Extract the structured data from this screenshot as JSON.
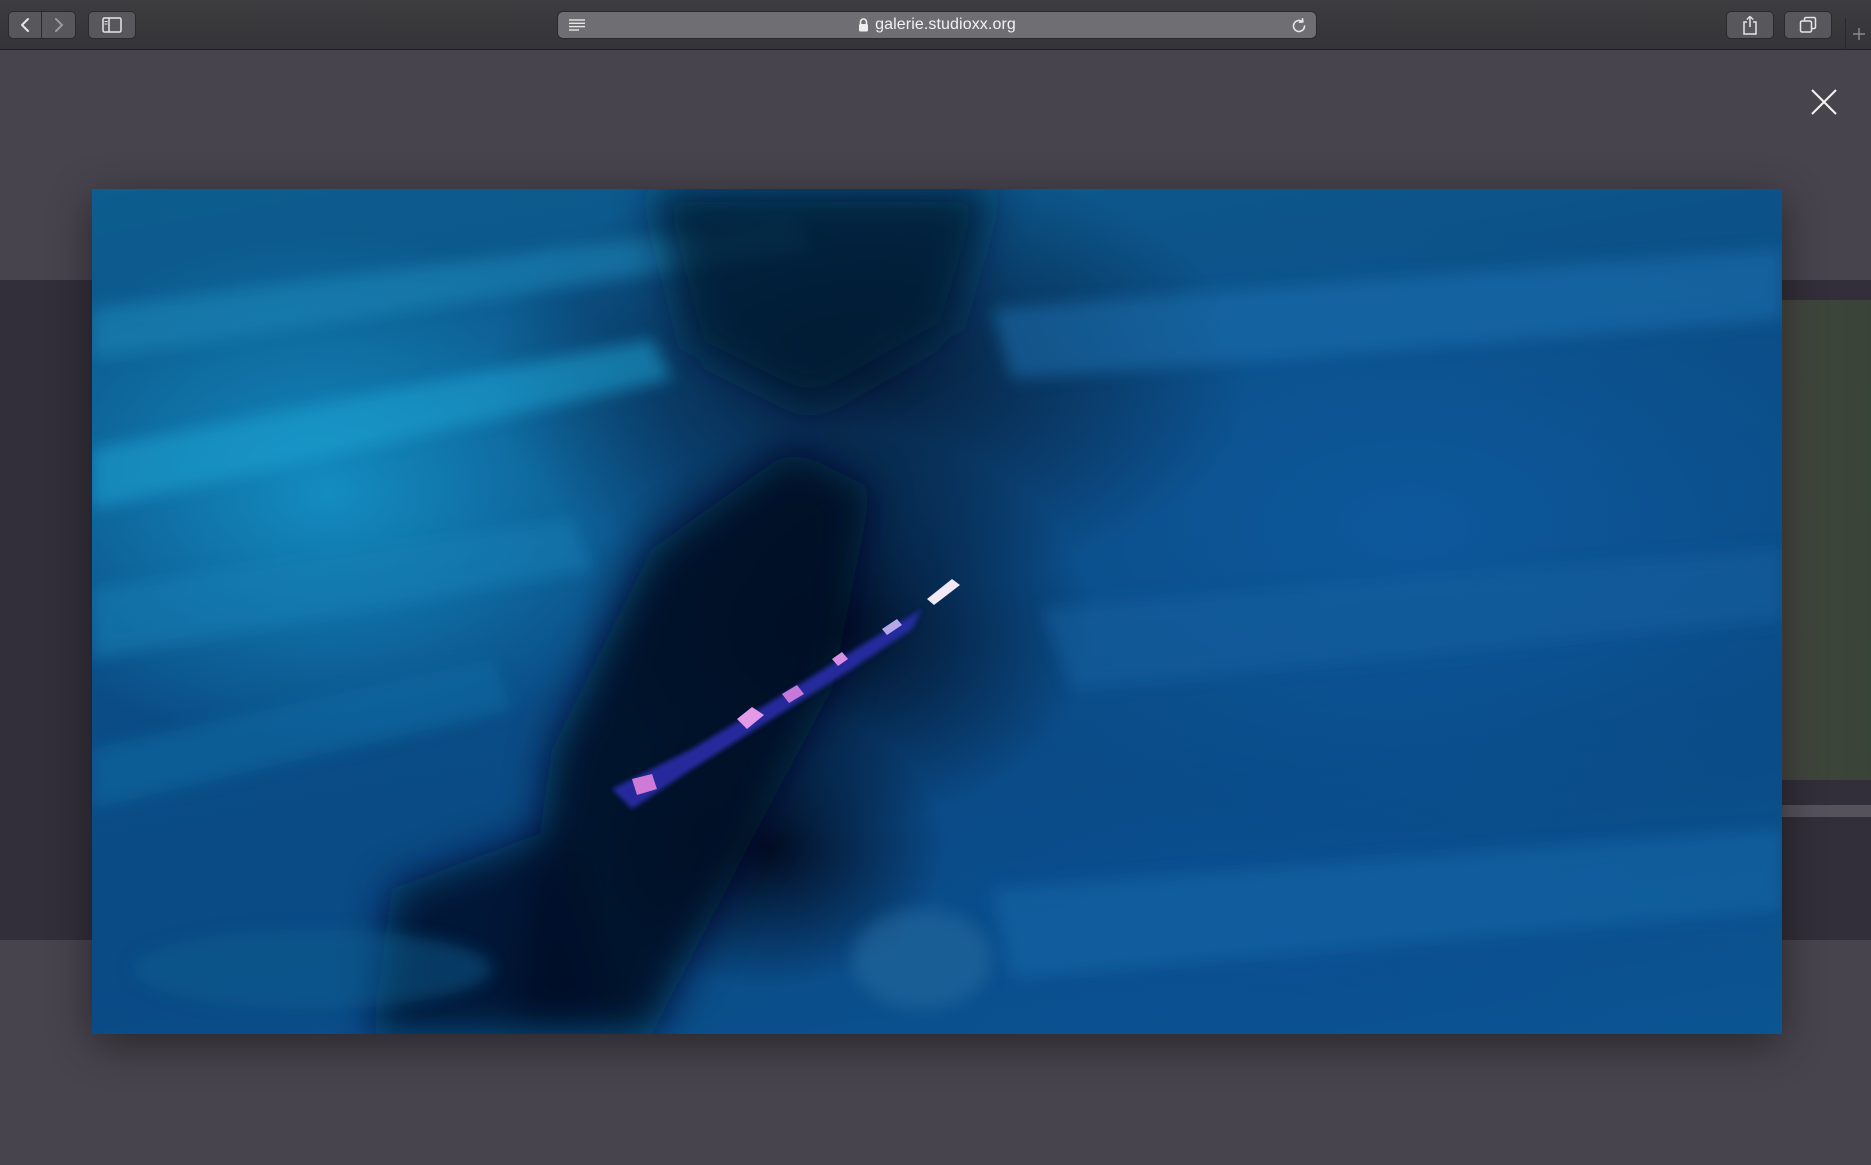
{
  "browser": {
    "url": "galerie.studioxx.org",
    "icons": {
      "back": "chevron-left-icon",
      "forward": "chevron-right-icon",
      "sidebar": "sidebar-icon",
      "reader": "reader-lines-icon",
      "lock": "lock-icon",
      "reload": "reload-icon",
      "share": "share-icon",
      "tabs": "tabs-overview-icon",
      "new_tab": "plus-icon"
    }
  },
  "lightbox": {
    "close_icon": "close-x-icon",
    "backdrop_color": "#48444e",
    "photo_dominant_color": "#0b4d86"
  }
}
